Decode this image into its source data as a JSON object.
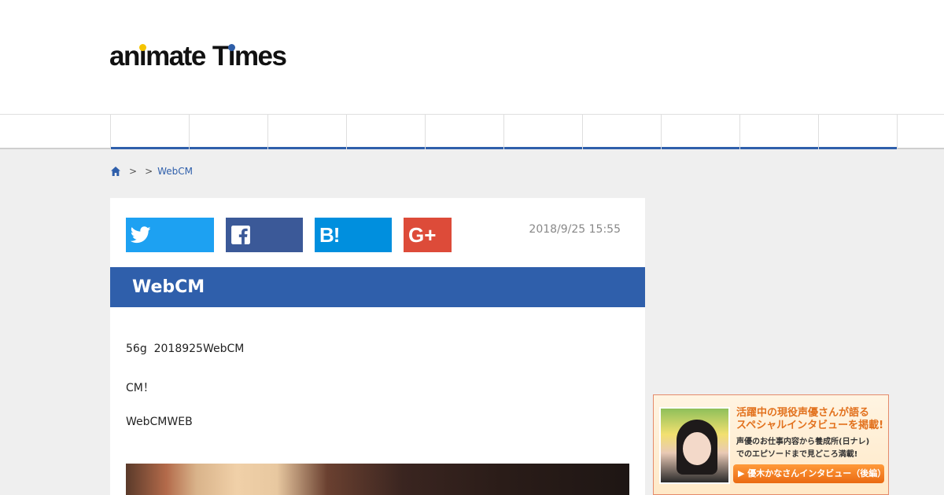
{
  "header": {
    "logo_part1": "an",
    "logo_i": "ı",
    "logo_part2": "mate",
    "logo_part3": "T",
    "logo_part4": "mes",
    "logo_times_i": "ı"
  },
  "colors": {
    "brand_blue": "#2f5fab",
    "logo_yellow": "#f5c400",
    "twitter": "#1da1f2",
    "facebook": "#3b5998",
    "hatena": "#008fde",
    "gplus": "#dd4b39"
  },
  "breadcrumb": {
    "home_icon": "home-icon",
    "sep1": ">",
    "sep2": ">",
    "current": "WebCM"
  },
  "share": {
    "twitter_icon": "twitter-icon",
    "facebook_icon": "facebook-icon",
    "hatena_label": "B!",
    "gplus_label": "G+"
  },
  "article": {
    "date": "2018/9/25 15:55",
    "title": "WebCM",
    "paragraphs": [
      "56g  2018925WebCM",
      "CM！",
      "WebCMWEB"
    ]
  },
  "ad": {
    "headline_line1": "活躍中の現役声優さんが語る",
    "headline_line2": "スペシャルインタビューを掲載!",
    "sub_line1": "声優のお仕事内容から養成所(日ナレ)",
    "sub_line2": "でのエピソードまで見どころ満載!",
    "button_label": "▶ 優木かなさんインタビュー（後編）"
  }
}
